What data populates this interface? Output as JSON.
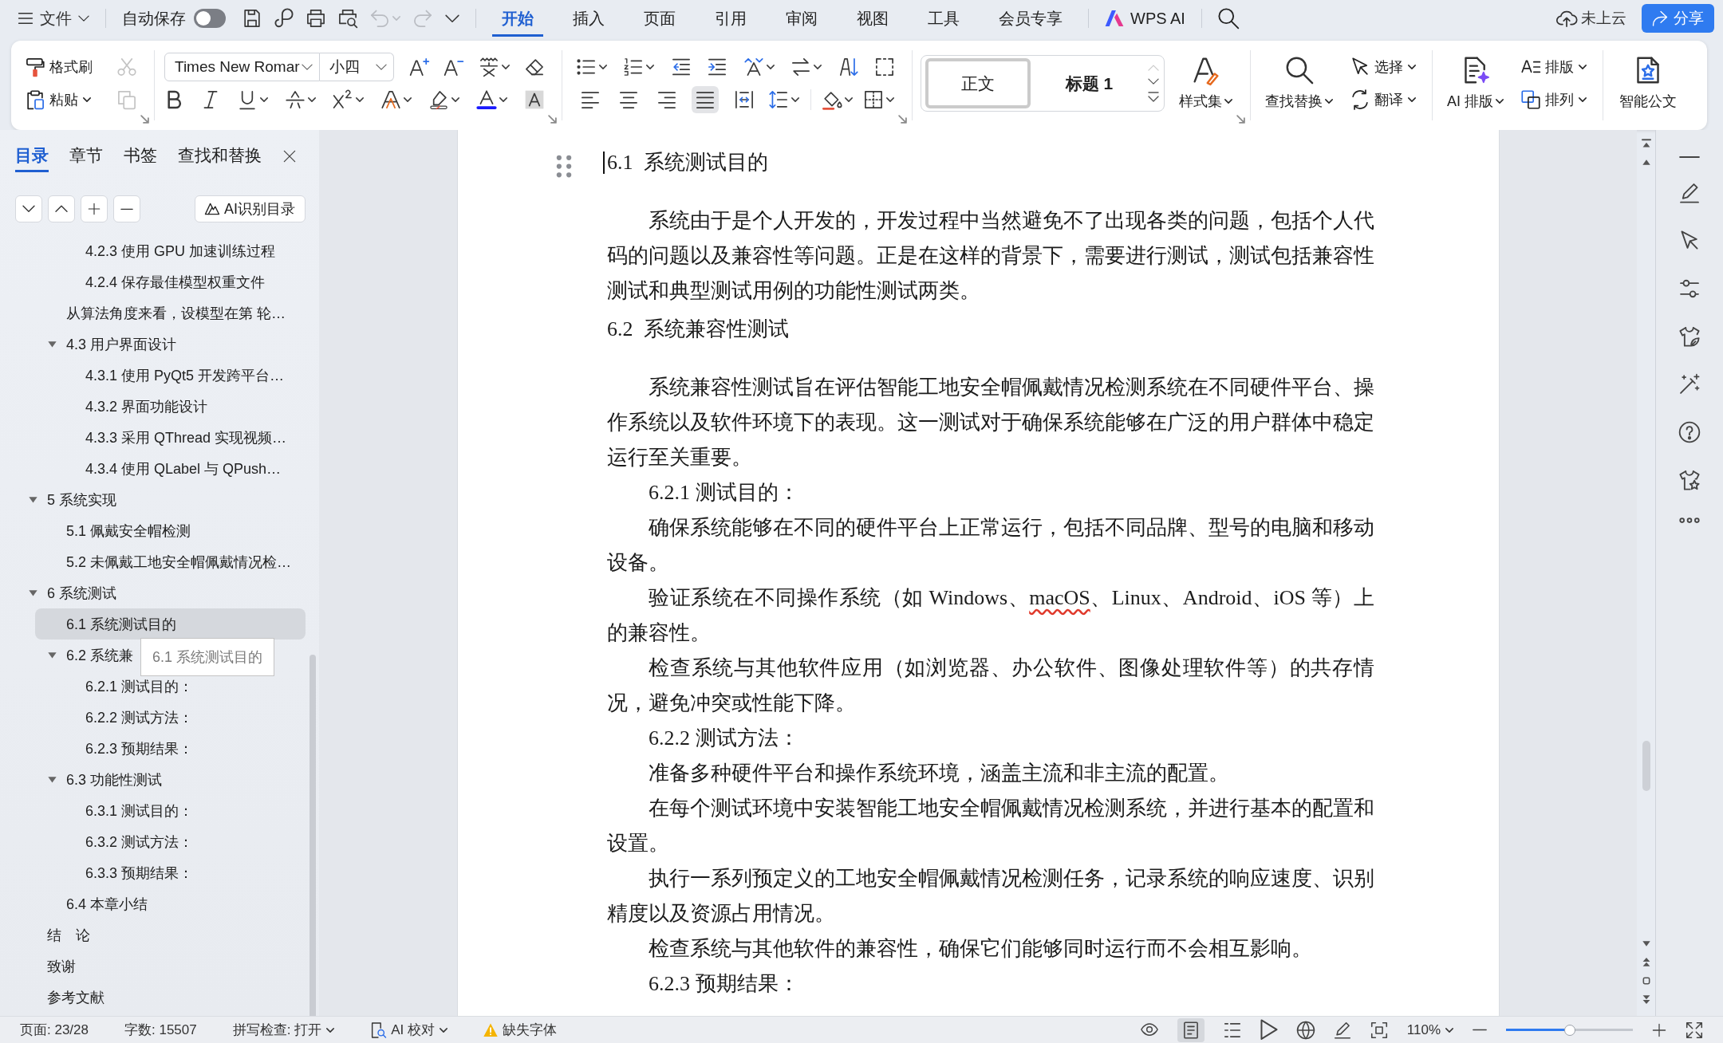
{
  "menu_bar": {
    "file_menu": {
      "label": "文件",
      "dropdown": true
    },
    "autosave": {
      "label": "自动保存",
      "on": false
    },
    "quick_access": [
      {
        "disabled": false,
        "dropdown": false
      },
      {
        "disabled": false,
        "dropdown": false
      },
      {
        "disabled": false,
        "dropdown": false
      },
      {
        "disabled": false,
        "dropdown": false
      },
      {
        "disabled": true,
        "dropdown": true
      },
      {
        "disabled": true,
        "dropdown": false
      },
      {
        "disabled": false,
        "dropdown": false
      }
    ],
    "tabs": [
      {
        "label": "开始",
        "selected": true
      },
      {
        "label": "插入",
        "selected": false
      },
      {
        "label": "页面",
        "selected": false
      },
      {
        "label": "引用",
        "selected": false
      },
      {
        "label": "审阅",
        "selected": false
      },
      {
        "label": "视图",
        "selected": false
      },
      {
        "label": "工具",
        "selected": false
      },
      {
        "label": "会员专享",
        "selected": false
      }
    ],
    "ai_button": {
      "label": "WPS AI"
    },
    "cloud_status": {
      "label": "未上云"
    },
    "share_button": {
      "label": "分享"
    }
  },
  "ribbon": {
    "groups": [
      {
        "kind": "rows",
        "launcher": true,
        "rows": [
          [
            {
              "kind": "button",
              "label": "格式刷",
              "disabled": false,
              "dropdown": false
            },
            {
              "kind": "button",
              "disabled": true,
              "dropdown": false
            }
          ],
          [
            {
              "kind": "button",
              "label": "粘贴",
              "disabled": false,
              "dropdown": true
            },
            {
              "kind": "button",
              "disabled": true,
              "dropdown": false
            }
          ]
        ]
      },
      {
        "kind": "rows",
        "launcher": true,
        "rows": [
          [
            {
              "kind": "combo",
              "value": "Times New Romar"
            },
            {
              "kind": "combo",
              "value": "小四"
            },
            {
              "kind": "button",
              "disabled": false,
              "dropdown": false
            },
            {
              "kind": "button",
              "disabled": false,
              "dropdown": false
            },
            {
              "kind": "button",
              "disabled": false,
              "dropdown": true
            },
            {
              "kind": "button",
              "disabled": false,
              "dropdown": false
            }
          ],
          [
            {
              "kind": "button",
              "disabled": false,
              "dropdown": false
            },
            {
              "kind": "button",
              "disabled": false,
              "dropdown": false
            },
            {
              "kind": "button",
              "disabled": false,
              "dropdown": true
            },
            {
              "kind": "button",
              "disabled": false,
              "dropdown": true
            },
            {
              "kind": "button",
              "disabled": false,
              "dropdown": true
            },
            {
              "kind": "button",
              "disabled": false,
              "dropdown": true
            },
            {
              "kind": "button",
              "disabled": false,
              "dropdown": true
            },
            {
              "kind": "button",
              "disabled": false,
              "dropdown": true
            },
            {
              "kind": "button",
              "disabled": false,
              "dropdown": false
            }
          ]
        ]
      },
      {
        "kind": "rows",
        "launcher": true,
        "rows": [
          [
            {
              "kind": "button",
              "disabled": false,
              "dropdown": true
            },
            {
              "kind": "button",
              "disabled": false,
              "dropdown": true
            },
            {
              "kind": "button",
              "disabled": false,
              "dropdown": false
            },
            {
              "kind": "button",
              "disabled": false,
              "dropdown": false
            },
            {
              "kind": "button",
              "disabled": false,
              "dropdown": true
            },
            {
              "kind": "button",
              "disabled": false,
              "dropdown": true
            },
            {
              "kind": "button",
              "disabled": false,
              "dropdown": false
            },
            {
              "kind": "button",
              "disabled": false,
              "dropdown": false
            }
          ],
          [
            {
              "kind": "button",
              "disabled": false,
              "dropdown": false,
              "selected": false
            },
            {
              "kind": "button",
              "disabled": false,
              "dropdown": false,
              "selected": false
            },
            {
              "kind": "button",
              "disabled": false,
              "dropdown": false,
              "selected": false
            },
            {
              "kind": "button",
              "disabled": false,
              "dropdown": false,
              "selected": true
            },
            {
              "kind": "button",
              "disabled": false,
              "dropdown": false,
              "selected": false
            },
            {
              "kind": "button",
              "disabled": false,
              "dropdown": true
            },
            {
              "kind": "button",
              "disabled": false,
              "dropdown": true
            },
            {
              "kind": "button",
              "disabled": false,
              "dropdown": true
            }
          ]
        ]
      },
      {
        "kind": "styles",
        "launcher": true,
        "styles": [
          {
            "label": "正文",
            "selected": true
          },
          {
            "label": "标题 1",
            "selected": false
          }
        ],
        "tools": [
          {
            "kind": "large",
            "label": "样式集",
            "dropdown": true
          }
        ]
      },
      {
        "kind": "mixed",
        "launcher": false,
        "tools": [
          {
            "kind": "large",
            "label": "查找替换",
            "dropdown": true
          },
          {
            "kind": "button",
            "label": "选择",
            "disabled": false,
            "dropdown": true
          },
          {
            "kind": "button",
            "label": "翻译",
            "disabled": false,
            "dropdown": true
          }
        ]
      },
      {
        "kind": "mixed",
        "launcher": false,
        "tools": [
          {
            "kind": "large",
            "label": "AI 排版",
            "dropdown": true
          },
          {
            "kind": "button",
            "label": "排版",
            "disabled": false,
            "dropdown": true
          },
          {
            "kind": "button",
            "label": "排列",
            "disabled": false,
            "dropdown": true
          }
        ]
      },
      {
        "kind": "mixed",
        "launcher": false,
        "tools": [
          {
            "kind": "large",
            "label": "智能公文",
            "dropdown": false
          }
        ]
      }
    ]
  },
  "navigation": {
    "tabs": [
      {
        "label": "目录",
        "selected": true
      },
      {
        "label": "章节",
        "selected": false
      },
      {
        "label": "书签",
        "selected": false
      },
      {
        "label": "查找和替换",
        "selected": false
      }
    ],
    "ai_button": {
      "label": "AI识别目录"
    },
    "toc": [
      {
        "children": [
          {
            "children": [
              {
                "label": "4.2.3 使用 GPU 加速训练过程",
                "selected": false
              },
              {
                "label": "4.2.4 保存最佳模型权重文件",
                "selected": false
              }
            ]
          },
          {
            "label": "从算法角度来看，设模型在第 轮…",
            "selected": false
          },
          {
            "label": "4.3 用户界面设计",
            "selected": false,
            "expanded": true,
            "children": [
              {
                "label": "4.3.1 使用 PyQt5 开发跨平台…",
                "selected": false
              },
              {
                "label": "4.3.2 界面功能设计",
                "selected": false
              },
              {
                "label": "4.3.3 采用 QThread 实现视频…",
                "selected": false
              },
              {
                "label": "4.3.4 使用 QLabel 与 QPush…",
                "selected": false
              }
            ]
          }
        ]
      },
      {
        "label": "5 系统实现",
        "selected": false,
        "expanded": true,
        "children": [
          {
            "label": "5.1 佩戴安全帽检测",
            "selected": false
          },
          {
            "label": "5.2 未佩戴工地安全帽佩戴情况检…",
            "selected": false
          }
        ]
      },
      {
        "label": "6 系统测试",
        "selected": false,
        "expanded": true,
        "children": [
          {
            "label": "6.1 系统测试目的",
            "selected": true
          },
          {
            "label": "6.2 系统兼",
            "selected": false,
            "expanded": true,
            "children": [
              {
                "label": "6.2.1 测试目的：",
                "selected": false
              },
              {
                "label": "6.2.2 测试方法：",
                "selected": false
              },
              {
                "label": "6.2.3 预期结果：",
                "selected": false
              }
            ]
          },
          {
            "label": "6.3 功能性测试",
            "selected": false,
            "expanded": true,
            "children": [
              {
                "label": "6.3.1 测试目的：",
                "selected": false
              },
              {
                "label": "6.3.2 测试方法：",
                "selected": false
              },
              {
                "label": "6.3.3 预期结果：",
                "selected": false
              }
            ]
          },
          {
            "label": "6.4 本章小结",
            "selected": false
          }
        ]
      },
      {
        "label": "结　论",
        "selected": false
      },
      {
        "label": "致谢",
        "selected": false
      },
      {
        "label": "参考文献",
        "selected": false
      }
    ],
    "tooltip": {
      "text": "6.1 系统测试目的"
    }
  },
  "document": {
    "blocks": [
      {
        "kind": "heading",
        "text": "6.1  系统测试目的",
        "caret": true
      },
      {
        "kind": "paragraph",
        "text": "系统由于是个人开发的，开发过程中当然避免不了出现各类的问题，包括个人代码的问题以及兼容性等问题。正是在这样的背景下，需要进行测试，测试包括兼容性测试和典型测试用例的功能性测试两类。",
        "caret": false
      },
      {
        "kind": "heading",
        "text": "6.2  系统兼容性测试",
        "caret": false
      },
      {
        "kind": "paragraph",
        "text": "系统兼容性测试旨在评估智能工地安全帽佩戴情况检测系统在不同硬件平台、操作系统以及软件环境下的表现。这一测试对于确保系统能够在广泛的用户群体中稳定运行至关重要。",
        "caret": false
      },
      {
        "kind": "subheading",
        "text": "6.2.1 测试目的：",
        "caret": false
      },
      {
        "kind": "paragraph",
        "text": "确保系统能够在不同的硬件平台上正常运行，包括不同品牌、型号的电脑和移动设备。",
        "caret": false
      },
      {
        "kind": "paragraph",
        "segments": [
          {
            "text": "验证系统在不同操作系统（如 Windows、",
            "misspelled": false
          },
          {
            "text": "macOS",
            "misspelled": true
          },
          {
            "text": "、Linux、Android、iOS 等）上的兼容性。",
            "misspelled": false
          }
        ],
        "caret": false
      },
      {
        "kind": "paragraph",
        "text": "检查系统与其他软件应用（如浏览器、办公软件、图像处理软件等）的共存情况，避免冲突或性能下降。",
        "caret": false
      },
      {
        "kind": "subheading",
        "text": "6.2.2 测试方法：",
        "caret": false
      },
      {
        "kind": "paragraph",
        "text": "准备多种硬件平台和操作系统环境，涵盖主流和非主流的配置。",
        "caret": false
      },
      {
        "kind": "paragraph",
        "text": "在每个测试环境中安装智能工地安全帽佩戴情况检测系统，并进行基本的配置和设置。",
        "caret": false
      },
      {
        "kind": "paragraph",
        "text": "执行一系列预定义的工地安全帽佩戴情况检测任务，记录系统的响应速度、识别精度以及资源占用情况。",
        "caret": false
      },
      {
        "kind": "paragraph",
        "text": "检查系统与其他软件的兼容性，确保它们能够同时运行而不会相互影响。",
        "caret": false
      },
      {
        "kind": "subheading",
        "text": "6.2.3 预期结果：",
        "caret": false
      }
    ]
  },
  "status_bar": {
    "page_info": "页面: 23/28",
    "word_count": "字数: 15507",
    "spell_check": {
      "label": "拼写检查: 打开",
      "dropdown": true
    },
    "ai_proofread": {
      "label": "AI 校对",
      "dropdown": true
    },
    "font_warning": {
      "label": "缺失字体"
    },
    "view_modes": [
      {
        "selected": false
      },
      {
        "selected": true
      },
      {
        "selected": false
      },
      {
        "selected": false
      },
      {
        "selected": false
      },
      {
        "selected": false
      }
    ],
    "zoom": {
      "label": "110%",
      "dropdown": true,
      "level": 0.5
    }
  }
}
